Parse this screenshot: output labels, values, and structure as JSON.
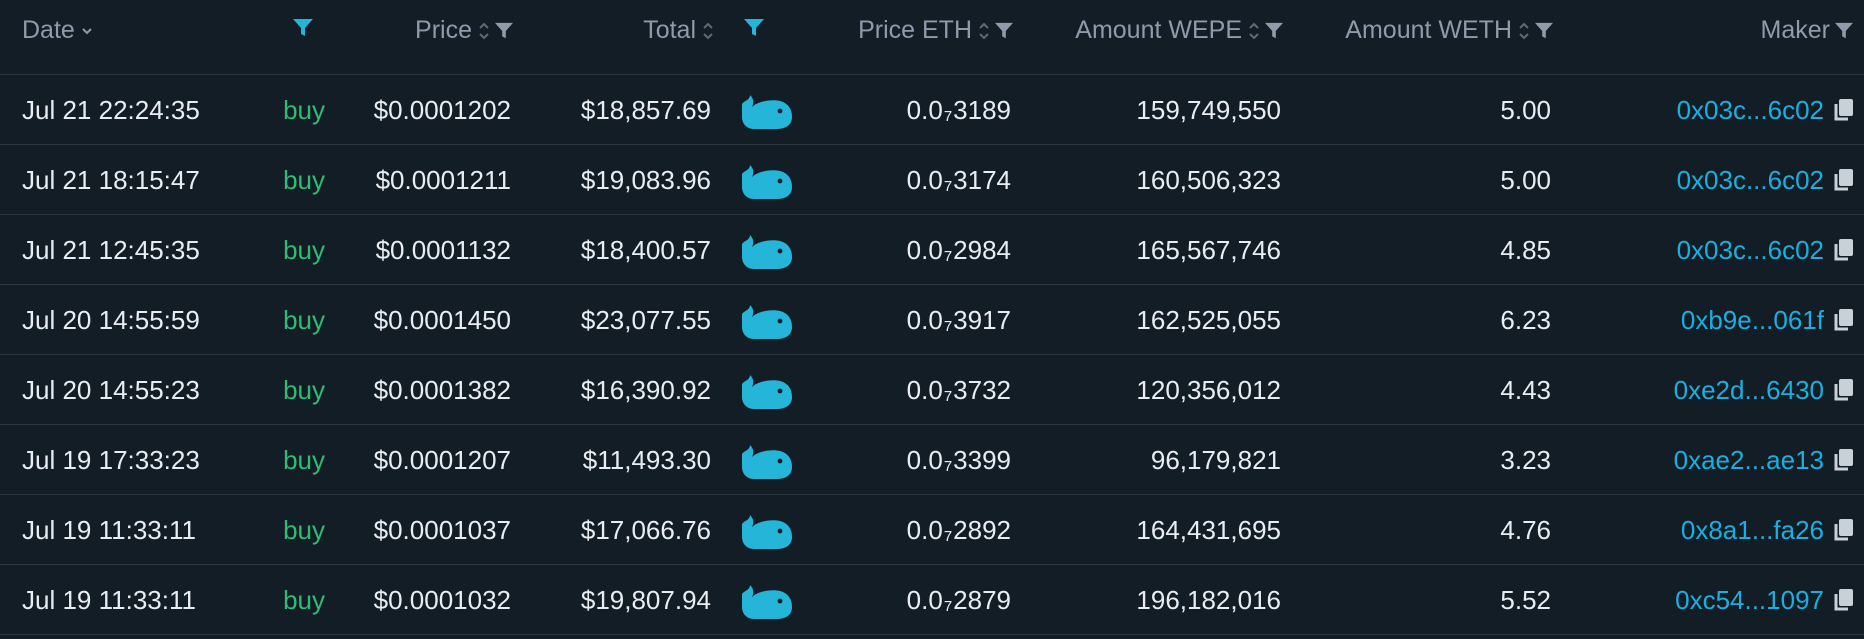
{
  "colors": {
    "background": "#131d26",
    "header_text": "#8f9bab",
    "text": "#e8edf2",
    "buy": "#2ebd71",
    "link": "#19b0e1",
    "accent": "#25b5d8",
    "border": "#2b3844"
  },
  "icons": {
    "sort": "chevron-down-icon",
    "sortable": "sort-up-down-icon",
    "filter": "filter-icon",
    "whale": "whale-icon",
    "copy": "copy-icon"
  },
  "header": {
    "date": "Date",
    "price": "Price",
    "total": "Total",
    "price_eth": "Price ETH",
    "amount_wepe": "Amount WEPE",
    "amount_weth": "Amount WETH",
    "maker": "Maker"
  },
  "rows": [
    {
      "date": "Jul 21 22:24:35",
      "type": "buy",
      "price": "$0.0001202",
      "total": "$18,857.69",
      "eth_prefix": "0.0",
      "eth_sub": "7",
      "eth_digits": "3189",
      "wepe": "159,749,550",
      "weth": "5.00",
      "maker": "0x03c...6c02"
    },
    {
      "date": "Jul 21 18:15:47",
      "type": "buy",
      "price": "$0.0001211",
      "total": "$19,083.96",
      "eth_prefix": "0.0",
      "eth_sub": "7",
      "eth_digits": "3174",
      "wepe": "160,506,323",
      "weth": "5.00",
      "maker": "0x03c...6c02"
    },
    {
      "date": "Jul 21 12:45:35",
      "type": "buy",
      "price": "$0.0001132",
      "total": "$18,400.57",
      "eth_prefix": "0.0",
      "eth_sub": "7",
      "eth_digits": "2984",
      "wepe": "165,567,746",
      "weth": "4.85",
      "maker": "0x03c...6c02"
    },
    {
      "date": "Jul 20 14:55:59",
      "type": "buy",
      "price": "$0.0001450",
      "total": "$23,077.55",
      "eth_prefix": "0.0",
      "eth_sub": "7",
      "eth_digits": "3917",
      "wepe": "162,525,055",
      "weth": "6.23",
      "maker": "0xb9e...061f"
    },
    {
      "date": "Jul 20 14:55:23",
      "type": "buy",
      "price": "$0.0001382",
      "total": "$16,390.92",
      "eth_prefix": "0.0",
      "eth_sub": "7",
      "eth_digits": "3732",
      "wepe": "120,356,012",
      "weth": "4.43",
      "maker": "0xe2d...6430"
    },
    {
      "date": "Jul 19 17:33:23",
      "type": "buy",
      "price": "$0.0001207",
      "total": "$11,493.30",
      "eth_prefix": "0.0",
      "eth_sub": "7",
      "eth_digits": "3399",
      "wepe": "96,179,821",
      "weth": "3.23",
      "maker": "0xae2...ae13"
    },
    {
      "date": "Jul 19 11:33:11",
      "type": "buy",
      "price": "$0.0001037",
      "total": "$17,066.76",
      "eth_prefix": "0.0",
      "eth_sub": "7",
      "eth_digits": "2892",
      "wepe": "164,431,695",
      "weth": "4.76",
      "maker": "0x8a1...fa26"
    },
    {
      "date": "Jul 19 11:33:11",
      "type": "buy",
      "price": "$0.0001032",
      "total": "$19,807.94",
      "eth_prefix": "0.0",
      "eth_sub": "7",
      "eth_digits": "2879",
      "wepe": "196,182,016",
      "weth": "5.52",
      "maker": "0xc54...1097"
    }
  ]
}
